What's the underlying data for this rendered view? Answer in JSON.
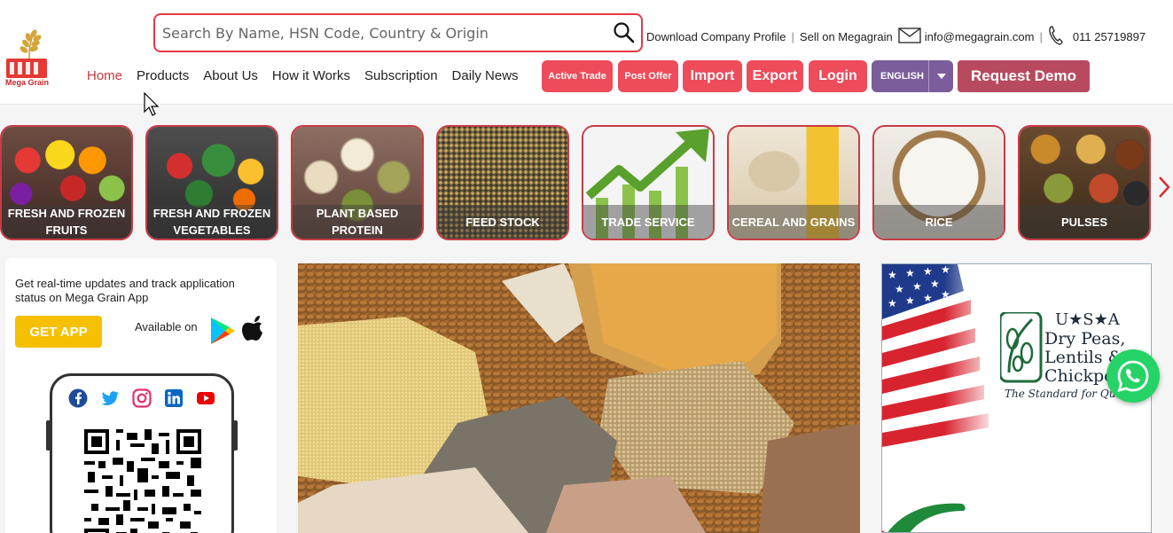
{
  "logo": {
    "name": "Mega Grain"
  },
  "search": {
    "placeholder": "Search By Name, HSN Code, Country & Origin"
  },
  "toplinks": {
    "download": "Download Company Profile",
    "sell": "Sell on Megagrain",
    "email": "info@megagrain.com",
    "phone": "011 25719897"
  },
  "nav": [
    "Home",
    "Products",
    "About Us",
    "How it Works",
    "Subscription",
    "Daily News"
  ],
  "buttons": {
    "active_trade": "Active Trade",
    "post_offer": "Post Offer",
    "import": "Import",
    "export": "Export",
    "login": "Login",
    "language": "ENGLISH",
    "request_demo": "Request Demo"
  },
  "categories": [
    {
      "label": "FRESH AND FROZEN FRUITS"
    },
    {
      "label": "FRESH AND FROZEN VEGETABLES"
    },
    {
      "label": "PLANT BASED PROTEIN"
    },
    {
      "label": "FEED STOCK"
    },
    {
      "label": "TRADE SERVICE"
    },
    {
      "label": "CEREAL AND GRAINS"
    },
    {
      "label": "RICE"
    },
    {
      "label": "PULSES"
    }
  ],
  "app": {
    "text": "Get real-time updates and track application status on Mega Grain App",
    "get_app": "GET APP",
    "available": "Available on"
  },
  "ad": {
    "line1": "U★S★A",
    "line2": "Dry Peas,",
    "line3": "Lentils &",
    "line4": "Chickpeas",
    "tagline": "The Standard for Quality"
  },
  "colors": {
    "accent": "#ee4b5b",
    "language": "#7a5d9a",
    "demo": "#b84a5f",
    "get_app": "#f5c000",
    "whatsapp": "#25d366"
  }
}
